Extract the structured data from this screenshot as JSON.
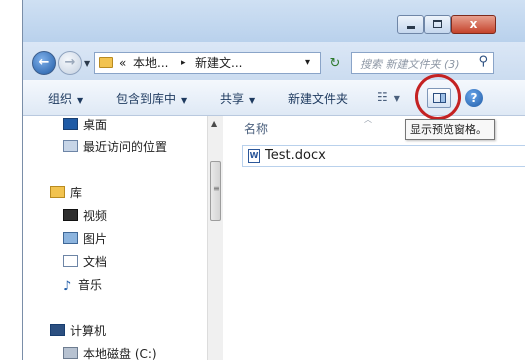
{
  "window": {
    "buttons": {
      "minimize": "",
      "maximize": "",
      "close": "x"
    }
  },
  "address": {
    "back_icon": "back-arrow-icon",
    "forward_icon": "forward-arrow-icon",
    "breadcrumb_prefix": "«",
    "crumb_1": "本地...",
    "crumb_sep": "▸",
    "crumb_2": "新建文...",
    "dropdown": "▾",
    "refresh": "↻",
    "search_placeholder": "搜索 新建文件夹 (3)",
    "search_icon": "⚲"
  },
  "toolbar": {
    "organize": "组织",
    "include_library": "包含到库中",
    "share": "共享",
    "new_folder": "新建文件夹",
    "dropdown_arrow": "▼",
    "view_icon": "☷",
    "help": "?"
  },
  "tooltip": {
    "text": "显示预览窗格。"
  },
  "nav": {
    "items": [
      {
        "label": "桌面",
        "icon": "desktop-icon"
      },
      {
        "label": "最近访问的位置",
        "icon": "recent-places-icon"
      },
      {
        "label": "库",
        "icon": "library-icon"
      },
      {
        "label": "视频",
        "icon": "video-icon"
      },
      {
        "label": "图片",
        "icon": "pictures-icon"
      },
      {
        "label": "文档",
        "icon": "documents-icon"
      },
      {
        "label": "音乐",
        "icon": "music-icon"
      },
      {
        "label": "计算机",
        "icon": "computer-icon"
      },
      {
        "label": "本地磁盘 (C:)",
        "icon": "disk-icon"
      }
    ]
  },
  "content": {
    "column_name": "名称",
    "files": [
      {
        "name": "Test.docx",
        "icon": "word-document-icon"
      }
    ]
  },
  "colors": {
    "annotation": "#c42222",
    "accent": "#1f5ba6"
  }
}
